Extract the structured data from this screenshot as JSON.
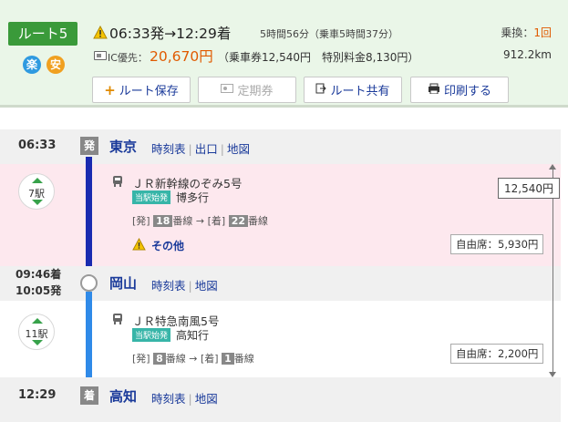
{
  "route": {
    "label": "ルート5",
    "badges": [
      "楽",
      "安"
    ],
    "times": "06:33発→12:29着",
    "duration": "5時間56分（乗車5時間37分）",
    "transfer_label": "乗換：",
    "transfer_count": "1回",
    "ic_label": "IC優先：",
    "fare": "20,670円",
    "fare_detail": "（乗車券12,540円　特別料金8,130円）",
    "distance": "912.2km"
  },
  "buttons": {
    "save": "ルート保存",
    "pass": "定期券",
    "share": "ルート共有",
    "print": "印刷する"
  },
  "stations": [
    {
      "time": "06:33",
      "tag": "発",
      "name": "東京",
      "links": [
        "時刻表",
        "出口",
        "地図"
      ]
    },
    {
      "time_arr": "09:46着",
      "time_dep": "10:05発",
      "name": "岡山",
      "links": [
        "時刻表",
        "地図"
      ]
    },
    {
      "time": "12:29",
      "tag": "着",
      "name": "高知",
      "links": [
        "時刻表",
        "地図"
      ]
    }
  ],
  "segments": [
    {
      "stops": "7駅",
      "train": "ＪＲ新幹線のぞみ5号",
      "origin_tag": "当駅始発",
      "dest": "博多行",
      "dep_label": "[発]",
      "dep_num": "18",
      "dep_suffix": "番線",
      "arr_label": "[着]",
      "arr_num": "22",
      "arr_suffix": "番線",
      "other": "その他",
      "seat": "自由席：5,930円"
    },
    {
      "stops": "11駅",
      "train": "ＪＲ特急南風5号",
      "origin_tag": "当駅始発",
      "dest": "高知行",
      "dep_label": "[発]",
      "dep_num": "8",
      "dep_suffix": "番線",
      "arr_label": "[着]",
      "arr_num": "1",
      "arr_suffix": "番線",
      "seat": "自由席：2,200円"
    }
  ],
  "fare_total": "12,540円",
  "colors": {
    "accent": "#3a9a3a",
    "fare": "#e05a00",
    "link": "#1a3a9a",
    "shinkansen": "#1a2ab0",
    "limited_express": "#2f8ae8",
    "segment_bg": "#fde8ee"
  }
}
